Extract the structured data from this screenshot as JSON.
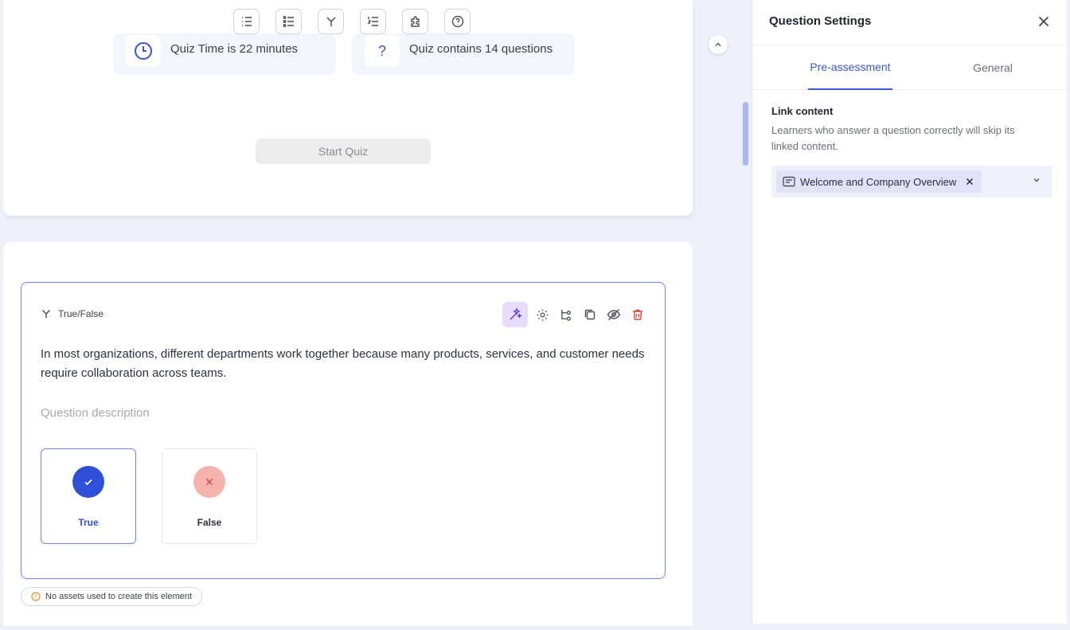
{
  "toolbar": {
    "icons": [
      "list-icon",
      "bullet-list-icon",
      "branch-icon",
      "numbered-list-icon",
      "puzzle-icon",
      "help-icon"
    ]
  },
  "quiz_info": {
    "time_text": "Quiz Time is 22 minutes",
    "questions_text": "Quiz contains 14 questions",
    "start_label": "Start Quiz"
  },
  "question": {
    "type_label": "True/False",
    "text": "In most organizations, different departments work together because many products, services, and customer needs require collaboration across teams.",
    "description_placeholder": "Question description",
    "options": [
      {
        "label": "True",
        "selected": true
      },
      {
        "label": "False",
        "selected": false
      }
    ],
    "asset_note": "No assets used to create this element"
  },
  "panel": {
    "title": "Question Settings",
    "tabs": [
      {
        "label": "Pre-assessment",
        "active": true
      },
      {
        "label": "General",
        "active": false
      }
    ],
    "link_title": "Link content",
    "link_description": "Learners who answer a question correctly will skip its linked content.",
    "selected_content": "Welcome and Company Overview"
  },
  "colors": {
    "accent": "#3d55d6",
    "selected_border": "#6f86ea",
    "delete": "#e0453b",
    "magic_bg": "#e6dcfb"
  }
}
